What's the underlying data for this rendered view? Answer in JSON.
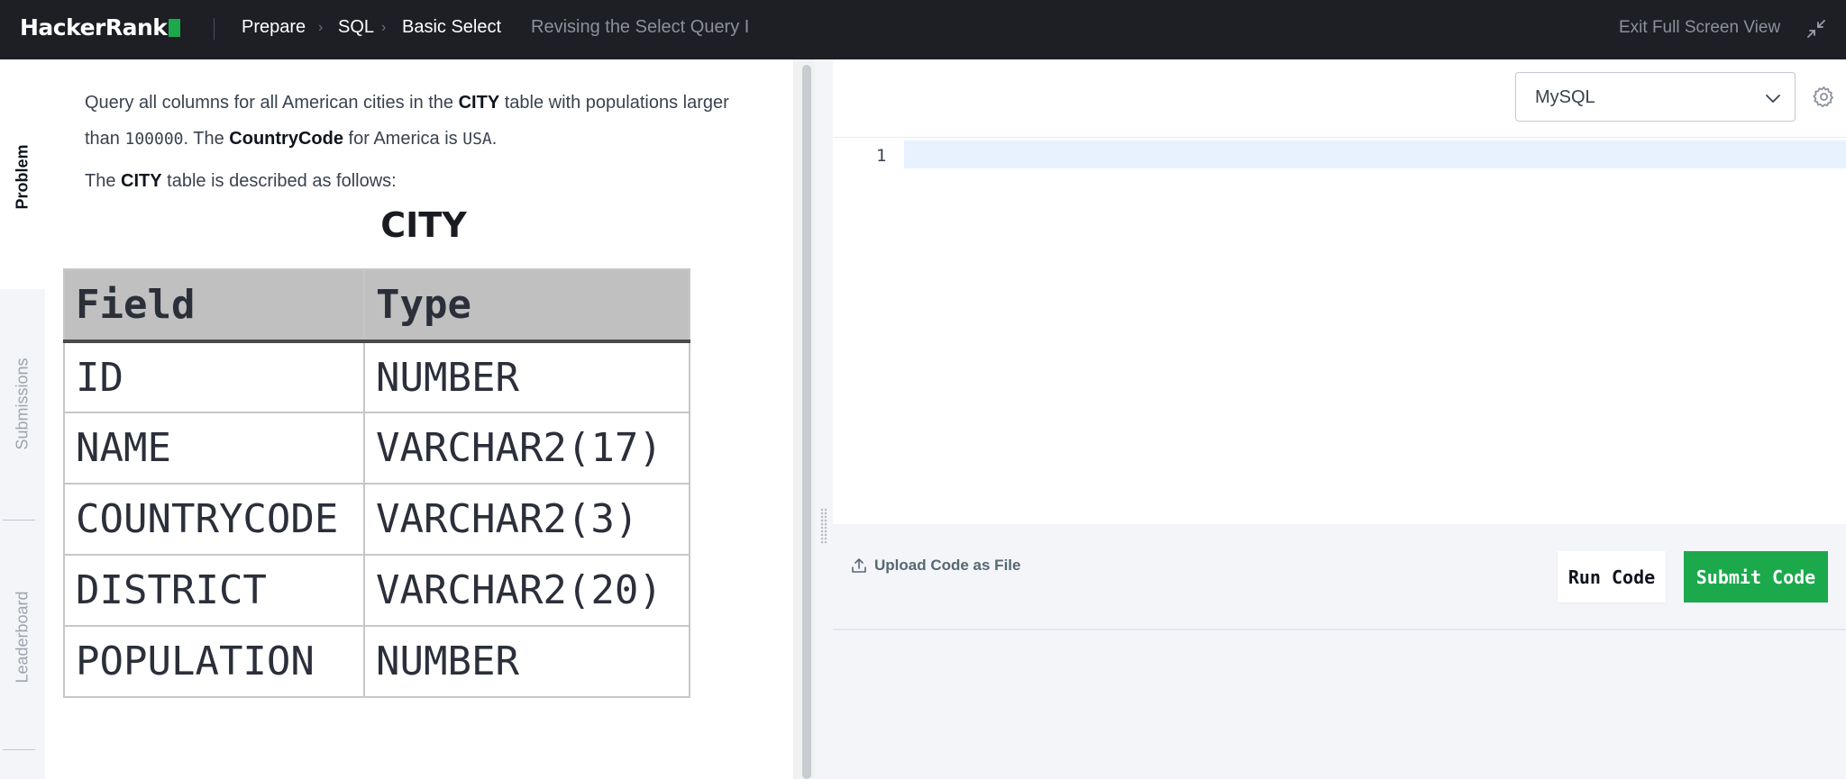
{
  "topbar": {
    "logo_text": "HackerRank",
    "breadcrumb": [
      "Prepare",
      "SQL",
      "Basic Select"
    ],
    "challenge_title": "Revising the Select Query I",
    "exit_fullscreen_label": "Exit Full Screen View"
  },
  "sidebar": {
    "tabs": [
      {
        "label": "Problem",
        "active": true
      },
      {
        "label": "Submissions",
        "active": false
      },
      {
        "label": "Leaderboard",
        "active": false
      }
    ]
  },
  "problem": {
    "p1_a": "Query all columns for all American cities in the ",
    "p1_b": "CITY",
    "p1_c": " table with populations larger",
    "p1_d": "than ",
    "p1_e": "100000",
    "p1_f": ". The ",
    "p1_g": "CountryCode",
    "p1_h": " for America is ",
    "p1_i": "USA",
    "p1_j": ".",
    "p2_a": "The ",
    "p2_b": "CITY",
    "p2_c": " table is described as follows:",
    "table": {
      "title": "CITY",
      "headers": [
        "Field",
        "Type"
      ],
      "rows": [
        [
          "ID",
          "NUMBER"
        ],
        [
          "NAME",
          "VARCHAR2(17)"
        ],
        [
          "COUNTRYCODE",
          "VARCHAR2(3)"
        ],
        [
          "DISTRICT",
          "VARCHAR2(20)"
        ],
        [
          "POPULATION",
          "NUMBER"
        ]
      ]
    }
  },
  "editor": {
    "language": "MySQL",
    "line_number": "1",
    "code": ""
  },
  "actions": {
    "upload_label": "Upload Code as File",
    "run_label": "Run Code",
    "submit_label": "Submit Code"
  },
  "colors": {
    "brand_green": "#1ba94c",
    "topbar_bg": "#1d1f25"
  }
}
